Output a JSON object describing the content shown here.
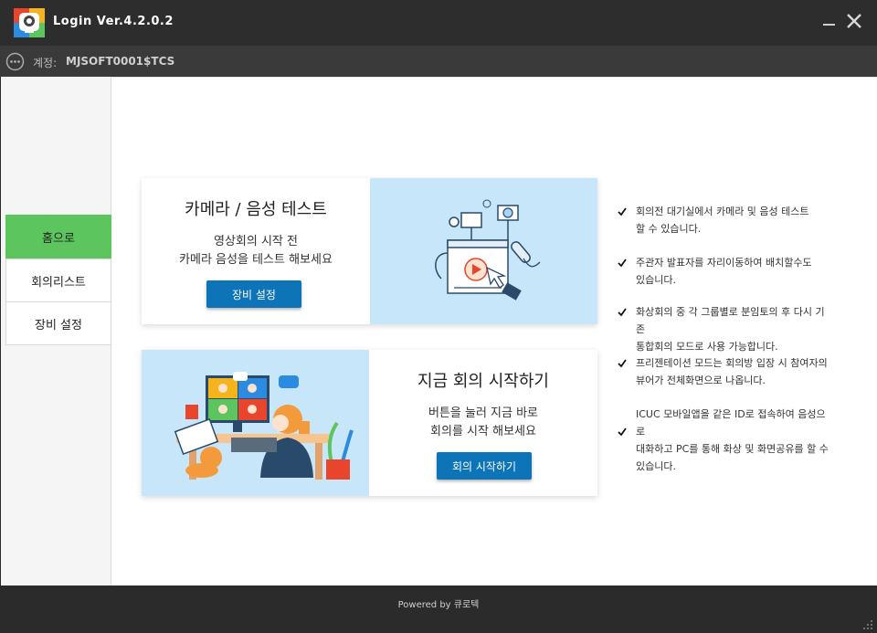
{
  "window": {
    "title": "Login Ver.4.2.0.2",
    "logo_icon": "webcam-logo-icon",
    "minimize_icon": "minimize-icon",
    "close_icon": "close-icon"
  },
  "account": {
    "label": "계정:",
    "value": "MJSOFT0001$TCS",
    "icon": "more-icon"
  },
  "sidebar": {
    "items": [
      {
        "label": "홈으로",
        "active": true
      },
      {
        "label": "회의리스트",
        "active": false
      },
      {
        "label": "장비 설정",
        "active": false
      }
    ]
  },
  "cards": {
    "test": {
      "title": "카메라 / 음성 테스트",
      "desc_line1": "영상회의 시작 전",
      "desc_line2": "카메라 음성을 테스트 해보세요",
      "button": "장비 설정"
    },
    "start": {
      "title": "지금 회의 시작하기",
      "desc_line1": "버튼을 눌러 지금 바로",
      "desc_line2": "회의를 시작 해보세요",
      "button": "회의 시작하기"
    }
  },
  "features": [
    {
      "line1": "회의전 대기실에서 카메라 및 음성 테스트",
      "line2": "할 수 있습니다."
    },
    {
      "line1": "주관자 발표자를 자리이동하여 배치할수도",
      "line2": "있습니다."
    },
    {
      "line1": "화상회의 중 각 그룹별로 분임토의 후 다시 기존",
      "line2": "통합회의 모드로 사용 가능합니다."
    },
    {
      "line1": "프리젠테이션 모드는 회의방 입장 시 참여자의",
      "line2": "뷰어가 전체화면으로 나옵니다."
    },
    {
      "line1": "ICUC 모바일앱을 같은 ID로 접속하여 음성으로",
      "line2": "대화하고 PC를 통해 화상 및 화면공유를 할 수",
      "line3": "있습니다."
    }
  ],
  "footer": {
    "powered": "Powered by 큐로텍"
  },
  "colors": {
    "accent_green": "#5cc55e",
    "button_blue": "#0d74b8",
    "illustration_bg": "#c8e6fa"
  }
}
